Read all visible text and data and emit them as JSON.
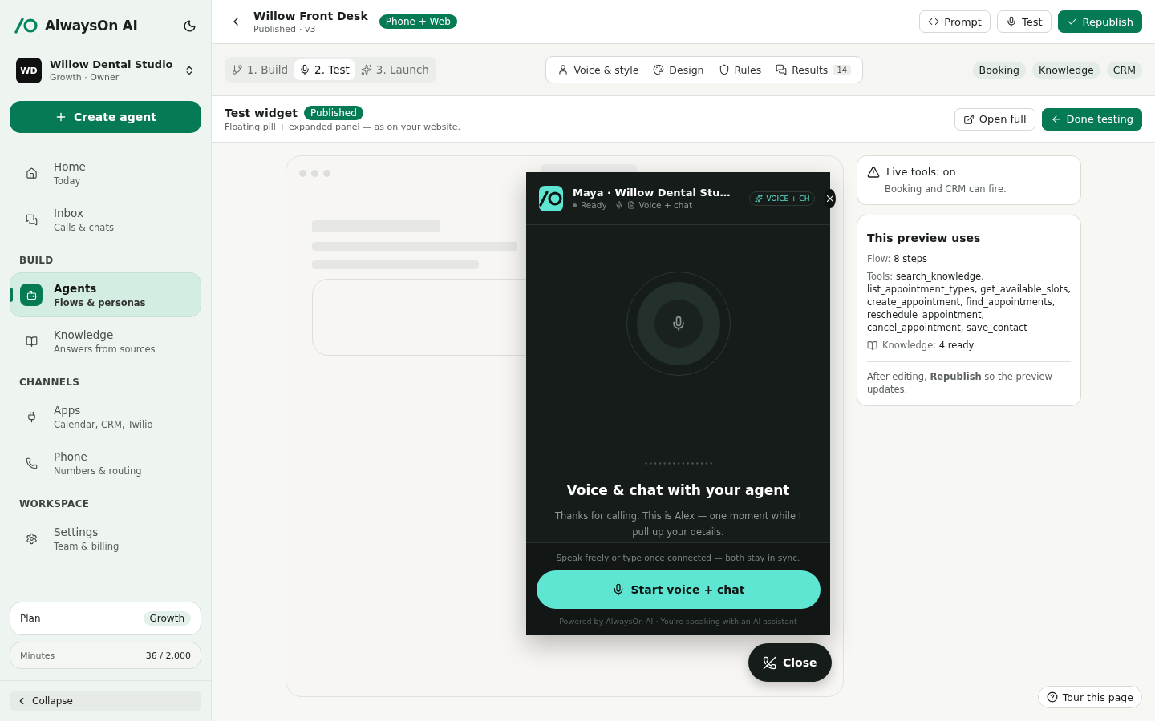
{
  "brand": {
    "name": "AlwaysOn AI"
  },
  "workspace": {
    "initials": "WD",
    "name": "Willow Dental Studio",
    "subtitle": "Growth · Owner"
  },
  "create_button": "Create agent",
  "nav_sections": [
    {
      "items": [
        {
          "label": "Home",
          "sub": "Today",
          "selected": false
        },
        {
          "label": "Inbox",
          "sub": "Calls & chats",
          "selected": false
        }
      ]
    },
    {
      "heading": "BUILD",
      "items": [
        {
          "label": "Agents",
          "sub": "Flows & personas",
          "selected": true
        },
        {
          "label": "Knowledge",
          "sub": "Answers from sources",
          "selected": false
        }
      ]
    },
    {
      "heading": "CHANNELS",
      "items": [
        {
          "label": "Apps",
          "sub": "Calendar, CRM, Twilio",
          "selected": false
        },
        {
          "label": "Phone",
          "sub": "Numbers & routing",
          "selected": false
        }
      ]
    },
    {
      "heading": "WORKSPACE",
      "items": [
        {
          "label": "Settings",
          "sub": "Team & billing",
          "selected": false
        }
      ]
    }
  ],
  "plan": {
    "label": "Plan",
    "value": "Growth"
  },
  "minutes": {
    "label": "Minutes",
    "value": "36 / 2,000"
  },
  "collapse": "Collapse",
  "header": {
    "title": "Willow Front Desk",
    "status": "Published",
    "version": "· v3",
    "badge": "Phone + Web",
    "buttons": [
      {
        "label": "Prompt",
        "primary": false
      },
      {
        "label": "Test",
        "primary": false
      },
      {
        "label": "Republish",
        "primary": true
      }
    ]
  },
  "steps": [
    {
      "label": "1. Build",
      "selected": false
    },
    {
      "label": "2. Test",
      "selected": true
    },
    {
      "label": "3. Launch",
      "selected": false
    }
  ],
  "sub_tabs": [
    {
      "label": "Voice & style"
    },
    {
      "label": "Design"
    },
    {
      "label": "Rules"
    },
    {
      "label": "Results",
      "count": "14"
    }
  ],
  "tags": [
    "Booking",
    "Knowledge",
    "CRM"
  ],
  "section": {
    "title": "Test widget",
    "badge": "Published",
    "subtitle": "Floating pill + expanded panel — as on your website.",
    "buttons": [
      {
        "label": "Open full",
        "primary": false
      },
      {
        "label": "Done testing",
        "primary": true
      }
    ]
  },
  "widget": {
    "agent_name": "Maya · Willow Dental Stu…",
    "status": "Ready",
    "mode": "Voice + chat",
    "badge": "VOICE + CH",
    "heading": "Voice & chat with your agent",
    "message": "Thanks for calling. This is Alex — one moment while I pull up your details.",
    "hint": "Speak freely or type once connected — both stay in sync.",
    "start_button": "Start voice + chat",
    "footer": "Powered by AlwaysOn AI · You're speaking with an AI assistant"
  },
  "close_button": "Close",
  "live_tools": {
    "title": "Live tools: on",
    "text": "Booking and CRM can fire."
  },
  "preview": {
    "title": "This preview uses",
    "rows": [
      {
        "label": "Flow:",
        "value": "8 steps"
      },
      {
        "label": "Tools:",
        "value": "search_knowledge, list_appointment_types, get_available_slots, create_appointment, find_appointments, reschedule_appointment, cancel_appointment, save_contact"
      }
    ],
    "knowledge": {
      "label": "Knowledge:",
      "value": "4 ready"
    },
    "note": "After editing, **Republish** so the preview updates."
  },
  "tour_button": "Tour this page"
}
